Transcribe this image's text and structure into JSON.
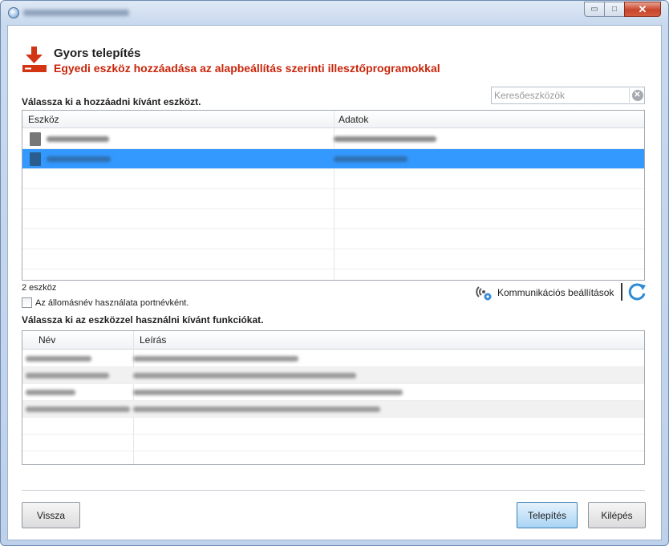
{
  "window": {
    "title": "",
    "controls": {
      "minimize": "▭",
      "maximize": "□",
      "close": "✕"
    }
  },
  "header": {
    "title": "Gyors telepítés",
    "subtitle": "Egyedi eszköz hozzáadása az alapbeállítás szerinti illesztőprogramokkal",
    "icon": "download-install-icon",
    "accent_color": "#c8250a"
  },
  "search": {
    "placeholder": "Keresőeszközök",
    "value": "",
    "clear_icon": "clear-search-icon"
  },
  "devices": {
    "heading": "Válassza ki a hozzáadni kívánt eszközt.",
    "columns": [
      "Eszköz",
      "Adatok"
    ],
    "rows": [
      {
        "device": "",
        "data": "",
        "selected": false
      },
      {
        "device": "",
        "data": "",
        "selected": true
      }
    ],
    "count_text": "2 eszköz",
    "selection_color": "#3399ff"
  },
  "hostname_option": {
    "label": "Az állomásnév használata portnévként.",
    "checked": false
  },
  "communication": {
    "label": "Kommunikációs beállítások",
    "icon": "communication-settings-icon",
    "refresh_icon": "refresh-icon"
  },
  "functions": {
    "heading": "Válassza ki az eszközzel használni kívánt funkciókat.",
    "columns": [
      "Név",
      "Leírás"
    ],
    "rows": [
      {
        "name": "",
        "description": ""
      },
      {
        "name": "",
        "description": ""
      },
      {
        "name": "",
        "description": ""
      },
      {
        "name": "",
        "description": ""
      }
    ]
  },
  "footer": {
    "back_label": "Vissza",
    "install_label": "Telepítés",
    "exit_label": "Kilépés"
  }
}
